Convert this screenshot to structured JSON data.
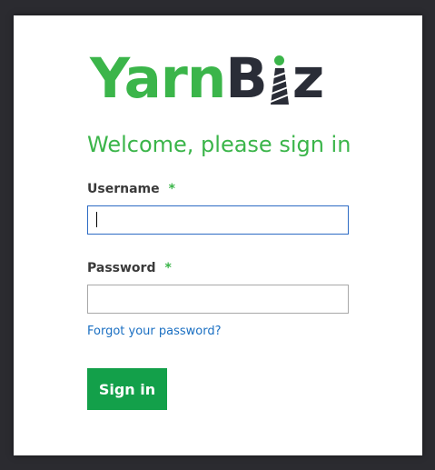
{
  "brand": {
    "logo_part_1": "Yarn",
    "logo_part_2": "B",
    "logo_part_3": "z",
    "colors": {
      "green": "#3bb54a",
      "dark": "#2a2d37",
      "button": "#13a04a",
      "link": "#1a6fc2"
    }
  },
  "form": {
    "title": "Welcome, please sign in",
    "username": {
      "label": "Username",
      "required_marker": "*",
      "value": "",
      "placeholder": ""
    },
    "password": {
      "label": "Password",
      "required_marker": "*",
      "value": "",
      "placeholder": ""
    },
    "forgot_link": "Forgot your password?",
    "submit_label": "Sign in"
  }
}
